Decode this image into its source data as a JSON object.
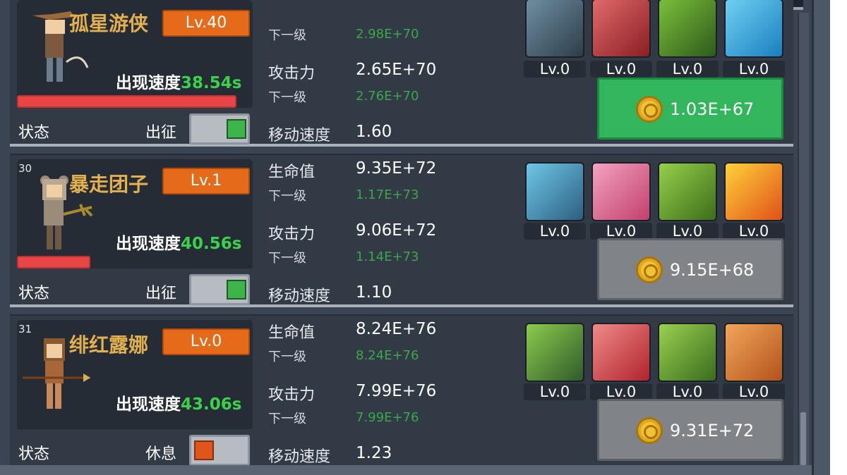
{
  "heroes": [
    {
      "index": "",
      "name": "孤星游侠",
      "level": "Lv.40",
      "spawn_label": "出现速度",
      "spawn_value": "38.54s",
      "status_label": "状态",
      "status_value": "出征",
      "status_on": true,
      "hp_fraction": 0.93,
      "hp_label": "",
      "hp_value": "",
      "hp_next_label": "下一级",
      "hp_next_value": "2.98E+70",
      "atk_label": "攻击力",
      "atk_value": "2.65E+70",
      "atk_next_label": "下一级",
      "atk_next_value": "2.76E+70",
      "move_label": "移动速度",
      "move_value": "1.60",
      "skills": [
        {
          "icon": "shield-slash-skill-icon",
          "level": "Lv.0"
        },
        {
          "icon": "crossbow-skill-icon",
          "level": "Lv.0"
        },
        {
          "icon": "boot-kick-skill-icon",
          "level": "Lv.0"
        },
        {
          "icon": "heal-boot-skill-icon",
          "level": "Lv.0"
        }
      ],
      "upgrade_price": "1.03E+67",
      "upgrade_affordable": true
    },
    {
      "index": "30",
      "name": "暴走团子",
      "level": "Lv.1",
      "spawn_label": "出现速度",
      "spawn_value": "40.56s",
      "status_label": "状态",
      "status_value": "出征",
      "status_on": true,
      "hp_fraction": 0.31,
      "hp_label": "生命值",
      "hp_value": "9.35E+72",
      "hp_next_label": "下一级",
      "hp_next_value": "1.17E+73",
      "atk_label": "攻击力",
      "atk_value": "9.06E+72",
      "atk_next_label": "下一级",
      "atk_next_value": "1.14E+73",
      "move_label": "移动速度",
      "move_value": "1.10",
      "skills": [
        {
          "icon": "hooded-assassin-skill-icon",
          "level": "Lv.0"
        },
        {
          "icon": "spear-skill-icon",
          "level": "Lv.0"
        },
        {
          "icon": "strength-skill-icon",
          "level": "Lv.0"
        },
        {
          "icon": "fire-boot-skill-icon",
          "level": "Lv.0"
        }
      ],
      "upgrade_price": "9.15E+68",
      "upgrade_affordable": false
    },
    {
      "index": "31",
      "name": "绯红露娜",
      "level": "Lv.0",
      "spawn_label": "出现速度",
      "spawn_value": "43.06s",
      "status_label": "状态",
      "status_value": "休息",
      "status_on": false,
      "hp_fraction": 0,
      "hp_label": "生命值",
      "hp_value": "8.24E+76",
      "hp_next_label": "下一级",
      "hp_next_value": "8.24E+76",
      "atk_label": "攻击力",
      "atk_value": "7.99E+76",
      "atk_next_label": "下一级",
      "atk_next_value": "7.99E+76",
      "move_label": "移动速度",
      "move_value": "1.23",
      "skills": [
        {
          "icon": "armored-knight-skill-icon",
          "level": "Lv.0"
        },
        {
          "icon": "lance-skill-icon",
          "level": "Lv.0"
        },
        {
          "icon": "muscle-skill-icon",
          "level": "Lv.0"
        },
        {
          "icon": "stomp-skill-icon",
          "level": "Lv.0"
        }
      ],
      "upgrade_price": "9.31E+72",
      "upgrade_affordable": false
    }
  ],
  "colors": {
    "panel": "#323a46",
    "level_badge": "#e56a1a",
    "toggle_on": "#3cb44a",
    "toggle_off": "#e0561a",
    "spawn_value": "#39d24a",
    "next_value": "#3aa84a",
    "buy_green": "#32b65c",
    "buy_gray": "#808387"
  }
}
